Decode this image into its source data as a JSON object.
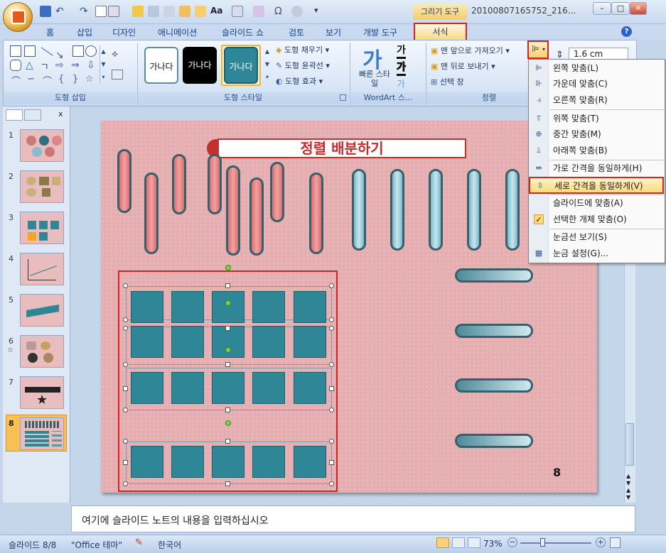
{
  "window": {
    "drawing_tools": "그리기 도구",
    "doc_title": "20100807165752_216...",
    "min": "–",
    "max": "□",
    "close": "✕"
  },
  "tabs": [
    "홈",
    "삽입",
    "디자인",
    "애니메이션",
    "슬라이드 쇼",
    "검토",
    "보기",
    "개발 도구"
  ],
  "active_tab": "서식",
  "ribbon": {
    "insert_shapes_label": "도형 삽입",
    "shape_styles_label": "도형 스타일",
    "style_samples": [
      "가나다",
      "가나다",
      "가나다"
    ],
    "shape_fill": "도형 채우기",
    "shape_outline": "도형 윤곽선",
    "shape_effects": "도형 효과",
    "wordart_label": "WordArt 스...",
    "quick_styles": "빠른 스타일",
    "wordart_glyph": "가",
    "bring_front": "맨 앞으로 가져오기",
    "send_back": "맨 뒤로 보내기",
    "selection_pane": "선택 창",
    "arrange_label": "정렬",
    "size_value": "1.6 cm"
  },
  "align_menu": [
    {
      "label": "왼쪽 맞춤(L)",
      "icon": "align-left-icon",
      "glyph": "⊫"
    },
    {
      "label": "가운데 맞춤(C)",
      "icon": "align-center-icon",
      "glyph": "⊪"
    },
    {
      "label": "오른쪽 맞춤(R)",
      "icon": "align-right-icon",
      "glyph": "⫣"
    },
    {
      "label": "위쪽 맞춤(T)",
      "icon": "align-top-icon",
      "glyph": "⫪"
    },
    {
      "label": "중간 맞춤(M)",
      "icon": "align-middle-icon",
      "glyph": "⊕"
    },
    {
      "label": "아래쪽 맞춤(B)",
      "icon": "align-bottom-icon",
      "glyph": "⫫"
    },
    {
      "label": "가로 간격을 동일하게(H)",
      "icon": "distribute-horizontal-icon",
      "glyph": "⇹"
    },
    {
      "label": "세로 간격을 동일하게(V)",
      "icon": "distribute-vertical-icon",
      "glyph": "⇳"
    },
    {
      "label": "슬라이드에 맞춤(A)",
      "icon": "",
      "glyph": ""
    },
    {
      "label": "선택한 개체 맞춤(O)",
      "icon": "checkmark-icon",
      "glyph": "✓"
    },
    {
      "label": "눈금선 보기(S)",
      "icon": "",
      "glyph": ""
    },
    {
      "label": "눈금 설정(G)...",
      "icon": "grid-icon",
      "glyph": "▦"
    }
  ],
  "slides": [
    "1",
    "2",
    "3",
    "4",
    "5",
    "6",
    "7",
    "8"
  ],
  "slide": {
    "title": "정렬 배분하기",
    "number": "8"
  },
  "notes_placeholder": "여기에 슬라이드 노트의 내용을 입력하십시오",
  "status": {
    "slide": "슬라이드 8/8",
    "theme": "\"Office 테마\"",
    "language": "한국어",
    "zoom": "73%"
  },
  "colors": {
    "highlight": "#e02020",
    "slide_bg": "#e5aeb0",
    "teal": "#2f8696",
    "pill_red": "#e58080",
    "pill_blue": "#a5d2dd"
  }
}
